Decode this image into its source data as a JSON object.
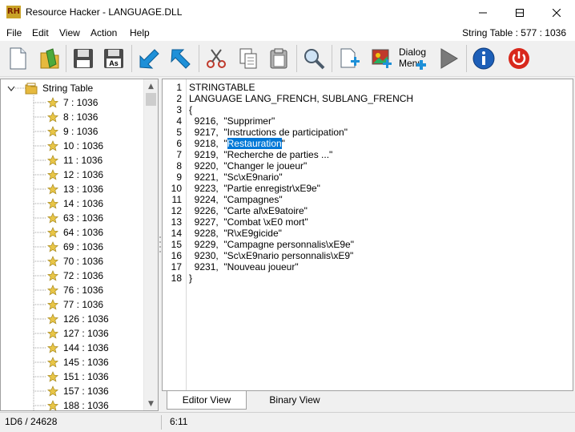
{
  "window": {
    "title": "Resource Hacker - LANGUAGE.DLL",
    "app_icon_text": "RH"
  },
  "menu": {
    "items": [
      "File",
      "Edit",
      "View",
      "Action",
      "Help"
    ],
    "status_right": "String Table : 577 : 1036"
  },
  "toolbar": {
    "buttons": [
      "new-file",
      "open-file",
      "save-file",
      "save-as",
      "back",
      "forward",
      "cut",
      "copy",
      "paste",
      "find",
      "add-resource",
      "add-image",
      "dialog-menu",
      "compile",
      "about",
      "exit"
    ],
    "dialog_menu_label_1": "Dialog",
    "dialog_menu_label_2": "Menu"
  },
  "tree": {
    "root_label": "String Table",
    "items": [
      "7 : 1036",
      "8 : 1036",
      "9 : 1036",
      "10 : 1036",
      "11 : 1036",
      "12 : 1036",
      "13 : 1036",
      "14 : 1036",
      "63 : 1036",
      "64 : 1036",
      "69 : 1036",
      "70 : 1036",
      "72 : 1036",
      "76 : 1036",
      "77 : 1036",
      "126 : 1036",
      "127 : 1036",
      "144 : 1036",
      "145 : 1036",
      "151 : 1036",
      "157 : 1036",
      "188 : 1036"
    ]
  },
  "editor": {
    "lines": [
      "STRINGTABLE",
      "LANGUAGE LANG_FRENCH, SUBLANG_FRENCH",
      "{",
      "  9216,  \"Supprimer\"",
      "  9217,  \"Instructions de participation\"",
      "  9218,  \"",
      "  9219,  \"Recherche de parties ...\"",
      "  9220,  \"Changer le joueur\"",
      "  9221,  \"Sc\\xE9nario\"",
      "  9223,  \"Partie enregistr\\xE9e\"",
      "  9224,  \"Campagnes\"",
      "  9226,  \"Carte al\\xE9atoire\"",
      "  9227,  \"Combat \\xE0 mort\"",
      "  9228,  \"R\\xE9gicide\"",
      "  9229,  \"Campagne personnalis\\xE9e\"",
      "  9230,  \"Sc\\xE9nario personnalis\\xE9\"",
      "  9231,  \"Nouveau joueur\"",
      "}"
    ],
    "line_numbers": [
      "1",
      "2",
      "3",
      "4",
      "5",
      "6",
      "7",
      "8",
      "9",
      "10",
      "11",
      "12",
      "13",
      "14",
      "15",
      "16",
      "17",
      "18"
    ],
    "selected_text": "Restauration",
    "selected_line_suffix": "\""
  },
  "tabs": {
    "editor_view": "Editor View",
    "binary_view": "Binary View"
  },
  "statusbar": {
    "left": "1D6 / 24628",
    "right": "6:11"
  },
  "colors": {
    "selection": "#0078d7",
    "star": "#e8c547",
    "folder": "#e6b93e"
  }
}
